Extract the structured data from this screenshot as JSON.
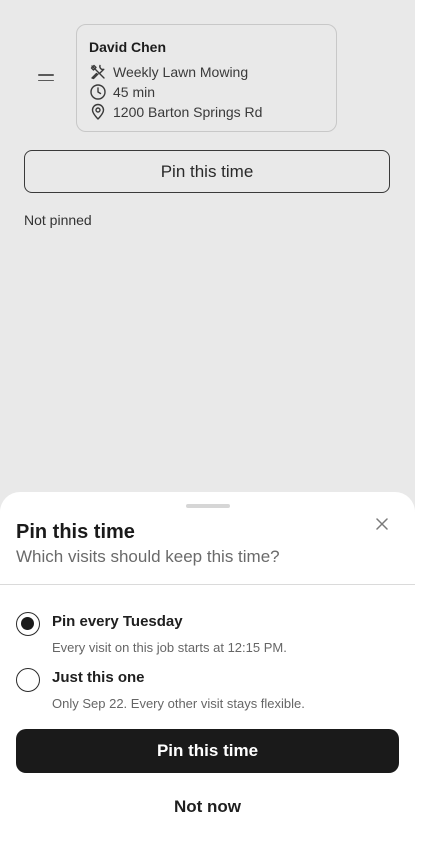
{
  "job_card": {
    "client_name": "David Chen",
    "service": "Weekly Lawn Mowing",
    "duration": "45 min",
    "address": "1200 Barton Springs Rd",
    "icons": [
      "tools-icon",
      "clock-icon",
      "location-pin-icon"
    ]
  },
  "pin_button_label": "Pin this time",
  "pin_status": "Not pinned",
  "sheet": {
    "title": "Pin this time",
    "subtitle": "Which visits should keep this time?",
    "options": [
      {
        "label": "Pin every Tuesday",
        "description": "Every visit on this job starts at 12:15 PM.",
        "selected": true
      },
      {
        "label": "Just this one",
        "description": "Only Sep 22. Every other visit stays flexible.",
        "selected": false
      }
    ],
    "primary_label": "Pin this time",
    "secondary_label": "Not now"
  },
  "colors": {
    "primary": "#1a1a1a",
    "background_dimmed": "#e9e9e9"
  }
}
